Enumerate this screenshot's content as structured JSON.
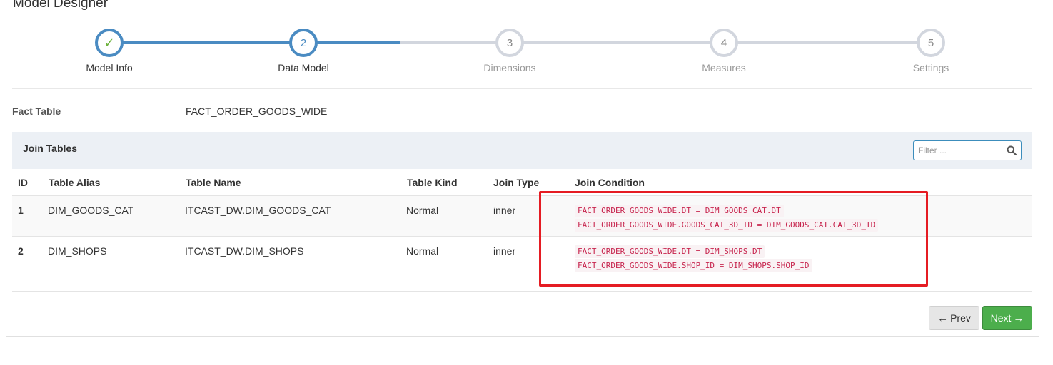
{
  "page": {
    "title": "Model Designer"
  },
  "wizard": {
    "steps": [
      {
        "number": "✓",
        "label": "Model Info",
        "state": "done"
      },
      {
        "number": "2",
        "label": "Data Model",
        "state": "active"
      },
      {
        "number": "3",
        "label": "Dimensions",
        "state": "todo"
      },
      {
        "number": "4",
        "label": "Measures",
        "state": "todo"
      },
      {
        "number": "5",
        "label": "Settings",
        "state": "todo"
      }
    ]
  },
  "fact": {
    "label": "Fact Table",
    "value": "FACT_ORDER_GOODS_WIDE"
  },
  "join": {
    "title": "Join Tables",
    "filter_placeholder": "Filter ...",
    "columns": [
      "ID",
      "Table Alias",
      "Table Name",
      "Table Kind",
      "Join Type",
      "Join Condition"
    ],
    "rows": [
      {
        "id": "1",
        "alias": "DIM_GOODS_CAT",
        "name": "ITCAST_DW.DIM_GOODS_CAT",
        "kind": "Normal",
        "type": "inner",
        "conditions": [
          "FACT_ORDER_GOODS_WIDE.DT = DIM_GOODS_CAT.DT",
          "FACT_ORDER_GOODS_WIDE.GOODS_CAT_3D_ID = DIM_GOODS_CAT.CAT_3D_ID"
        ]
      },
      {
        "id": "2",
        "alias": "DIM_SHOPS",
        "name": "ITCAST_DW.DIM_SHOPS",
        "kind": "Normal",
        "type": "inner",
        "conditions": [
          "FACT_ORDER_GOODS_WIDE.DT = DIM_SHOPS.DT",
          "FACT_ORDER_GOODS_WIDE.SHOP_ID = DIM_SHOPS.SHOP_ID"
        ]
      }
    ]
  },
  "buttons": {
    "prev": "Prev",
    "next": "Next"
  },
  "colors": {
    "accent": "#4a8bc2",
    "success": "#4cae4c",
    "highlight": "#e51c23",
    "code": "#c7254e"
  },
  "icons": {
    "search": "search-icon",
    "prev": "arrow-left-icon",
    "next": "arrow-right-icon",
    "done": "checkmark-icon"
  }
}
